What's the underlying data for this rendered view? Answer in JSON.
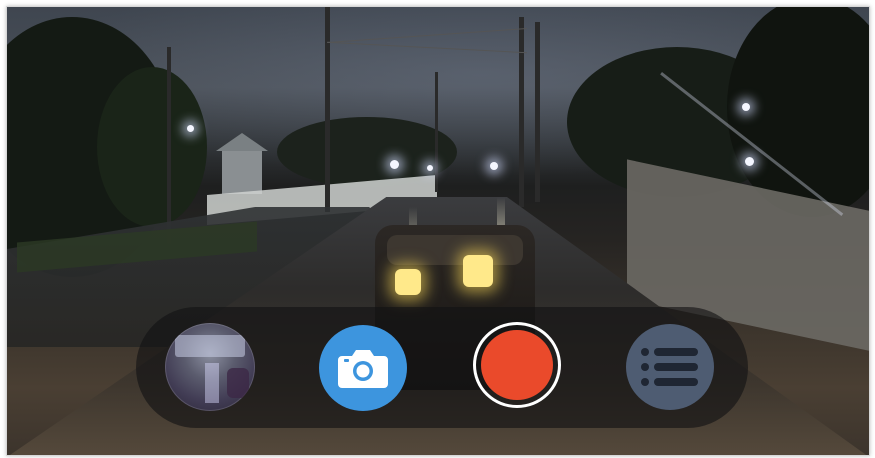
{
  "app": {
    "view": "dashcam-live-view"
  },
  "controls": {
    "gallery_thumbnail_icon": "gallery-thumbnail",
    "snapshot_icon": "camera-icon",
    "record_icon": "record-icon",
    "menu_icon": "list-menu-icon"
  },
  "colors": {
    "snapshot_button": "#3d95de",
    "record_button": "#ea4a2b",
    "record_ring": "#ffffff",
    "menu_button": "#4e5c72",
    "control_bar": "rgba(18,18,20,0.62)"
  }
}
